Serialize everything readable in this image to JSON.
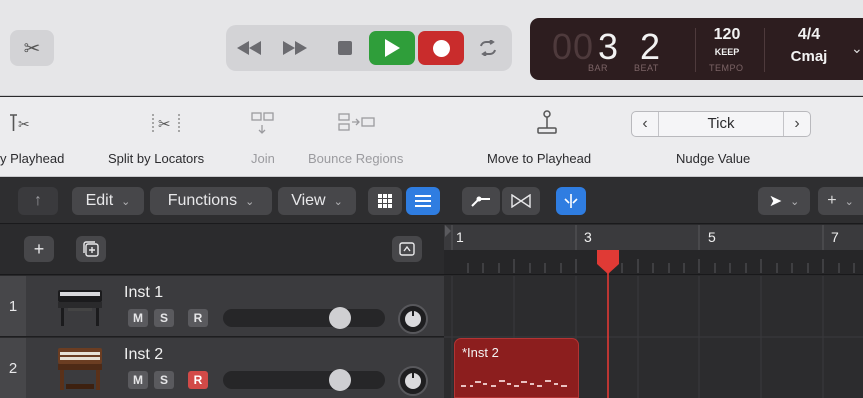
{
  "transport": {
    "bar_ghost": "00",
    "bar": "3",
    "beat": "2",
    "bar_label": "BAR",
    "beat_label": "BEAT",
    "tempo": "120",
    "tempo_mode": "KEEP",
    "tempo_label": "TEMPO",
    "time_signature": "4/4",
    "key": "Cmaj"
  },
  "toolbar": {
    "tools": [
      {
        "label": "y Playhead",
        "icon": "split-at-playhead-icon",
        "enabled": true
      },
      {
        "label": "Split by Locators",
        "icon": "split-by-locators-icon",
        "enabled": true
      },
      {
        "label": "Join",
        "icon": "join-icon",
        "enabled": false
      },
      {
        "label": "Bounce Regions",
        "icon": "bounce-regions-icon",
        "enabled": false
      },
      {
        "label": "Move to Playhead",
        "icon": "move-to-playhead-icon",
        "enabled": true
      }
    ],
    "nudge": {
      "value": "Tick",
      "label": "Nudge Value"
    }
  },
  "menubar": {
    "edit": "Edit",
    "functions": "Functions",
    "view": "View"
  },
  "ruler": {
    "bars": [
      "1",
      "3",
      "5",
      "7"
    ],
    "playhead_bar": 3.2
  },
  "tracks": [
    {
      "number": "1",
      "name": "Inst 1",
      "mute": "M",
      "solo": "S",
      "record": "R",
      "record_armed": false,
      "volume": 0.8,
      "instrument_icon": "electric-piano-icon"
    },
    {
      "number": "2",
      "name": "Inst 2",
      "mute": "M",
      "solo": "S",
      "record": "R",
      "record_armed": true,
      "volume": 0.8,
      "instrument_icon": "organ-icon"
    }
  ],
  "regions": [
    {
      "track": 2,
      "name": "*Inst 2",
      "color": "#8c1e1e"
    }
  ],
  "colors": {
    "play": "#2f9e3a",
    "record": "#c92c2c",
    "playhead": "#e03a35",
    "accent": "#2f7de1"
  }
}
